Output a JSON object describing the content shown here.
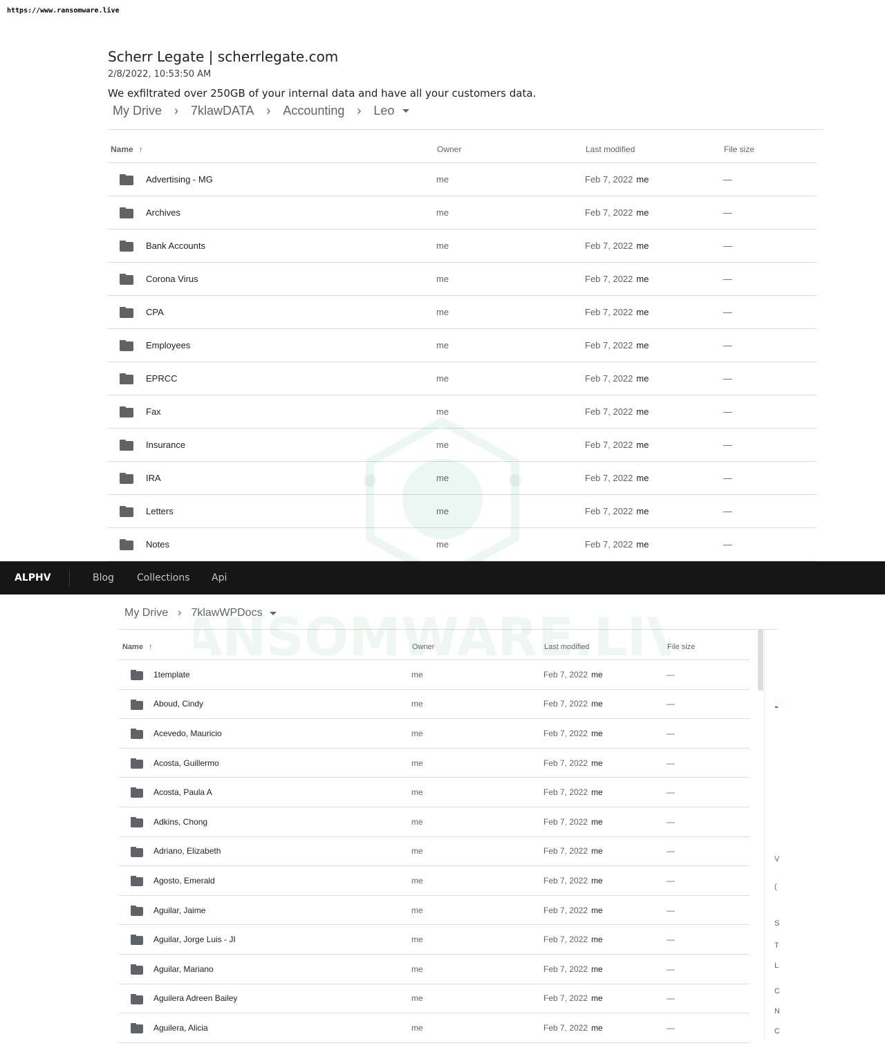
{
  "url": "https://www.ransomware.live",
  "post": {
    "title": "Scherr Legate | scherrlegate.com",
    "date": "2/8/2022, 10:53:50 AM",
    "description": "We exfiltrated over 250GB of your internal data and have all your customers data."
  },
  "drive1": {
    "breadcrumb": [
      "My Drive",
      "7klawDATA",
      "Accounting",
      "Leo"
    ],
    "columns": {
      "name": "Name",
      "owner": "Owner",
      "modified": "Last modified",
      "size": "File size"
    },
    "rows": [
      {
        "name": "Advertising - MG",
        "owner": "me",
        "date": "Feb 7, 2022",
        "by": "me",
        "size": "—"
      },
      {
        "name": "Archives",
        "owner": "me",
        "date": "Feb 7, 2022",
        "by": "me",
        "size": "—"
      },
      {
        "name": "Bank Accounts",
        "owner": "me",
        "date": "Feb 7, 2022",
        "by": "me",
        "size": "—"
      },
      {
        "name": "Corona Virus",
        "owner": "me",
        "date": "Feb 7, 2022",
        "by": "me",
        "size": "—"
      },
      {
        "name": "CPA",
        "owner": "me",
        "date": "Feb 7, 2022",
        "by": "me",
        "size": "—"
      },
      {
        "name": "Employees",
        "owner": "me",
        "date": "Feb 7, 2022",
        "by": "me",
        "size": "—"
      },
      {
        "name": "EPRCC",
        "owner": "me",
        "date": "Feb 7, 2022",
        "by": "me",
        "size": "—"
      },
      {
        "name": "Fax",
        "owner": "me",
        "date": "Feb 7, 2022",
        "by": "me",
        "size": "—"
      },
      {
        "name": "Insurance",
        "owner": "me",
        "date": "Feb 7, 2022",
        "by": "me",
        "size": "—"
      },
      {
        "name": "IRA",
        "owner": "me",
        "date": "Feb 7, 2022",
        "by": "me",
        "size": "—"
      },
      {
        "name": "Letters",
        "owner": "me",
        "date": "Feb 7, 2022",
        "by": "me",
        "size": "—"
      },
      {
        "name": "Notes",
        "owner": "me",
        "date": "Feb 7, 2022",
        "by": "me",
        "size": "—"
      }
    ]
  },
  "navbar": {
    "brand": "ALPHV",
    "links": [
      "Blog",
      "Collections",
      "Api"
    ]
  },
  "drive2": {
    "breadcrumb": [
      "My Drive",
      "7klawWPDocs"
    ],
    "columns": {
      "name": "Name",
      "owner": "Owner",
      "modified": "Last modified",
      "size": "File size"
    },
    "rows": [
      {
        "name": "1template",
        "owner": "me",
        "date": "Feb 7, 2022",
        "by": "me",
        "size": "—"
      },
      {
        "name": "Aboud, Cindy",
        "owner": "me",
        "date": "Feb 7, 2022",
        "by": "me",
        "size": "—"
      },
      {
        "name": "Acevedo, Mauricio",
        "owner": "me",
        "date": "Feb 7, 2022",
        "by": "me",
        "size": "—"
      },
      {
        "name": "Acosta, Guillermo",
        "owner": "me",
        "date": "Feb 7, 2022",
        "by": "me",
        "size": "—"
      },
      {
        "name": "Acosta, Paula A",
        "owner": "me",
        "date": "Feb 7, 2022",
        "by": "me",
        "size": "—"
      },
      {
        "name": "Adkins, Chong",
        "owner": "me",
        "date": "Feb 7, 2022",
        "by": "me",
        "size": "—"
      },
      {
        "name": "Adriano, Elizabeth",
        "owner": "me",
        "date": "Feb 7, 2022",
        "by": "me",
        "size": "—"
      },
      {
        "name": "Agosto, Emerald",
        "owner": "me",
        "date": "Feb 7, 2022",
        "by": "me",
        "size": "—"
      },
      {
        "name": "Aguilar, Jaime",
        "owner": "me",
        "date": "Feb 7, 2022",
        "by": "me",
        "size": "—"
      },
      {
        "name": "Aguilar, Jorge Luis - JI",
        "owner": "me",
        "date": "Feb 7, 2022",
        "by": "me",
        "size": "—"
      },
      {
        "name": "Aguilar, Mariano",
        "owner": "me",
        "date": "Feb 7, 2022",
        "by": "me",
        "size": "—"
      },
      {
        "name": "Aguilera Adreen Bailey",
        "owner": "me",
        "date": "Feb 7, 2022",
        "by": "me",
        "size": "—"
      },
      {
        "name": "Aguilera, Alicia",
        "owner": "me",
        "date": "Feb 7, 2022",
        "by": "me",
        "size": "—"
      }
    ]
  },
  "side_fragments": [
    "V",
    "(",
    "S",
    "T",
    "L",
    "C",
    "N",
    "C"
  ],
  "watermark": {
    "text": "RANSOMWARE.LIVE",
    "color": "#2e9e6b"
  },
  "colors": {
    "navbar_bg": "#161616",
    "divider": "#dadce0",
    "folder": "#5f6368",
    "accent_blue": "#1a73e8"
  }
}
